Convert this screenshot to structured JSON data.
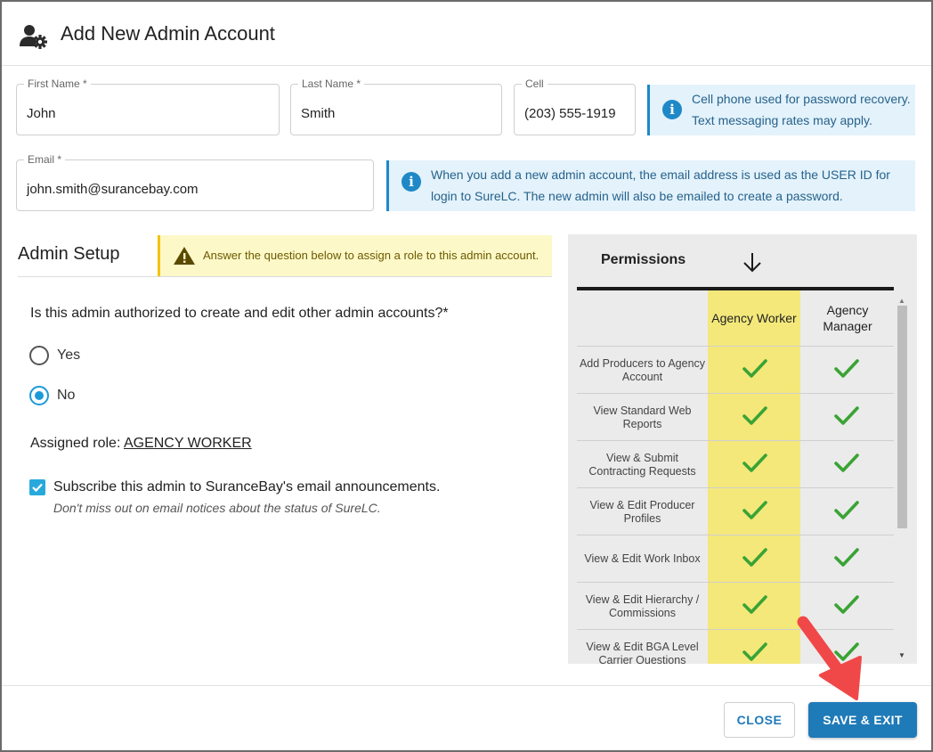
{
  "dialog": {
    "title": "Add New Admin Account",
    "title_icon": "user-gear-icon"
  },
  "form": {
    "first_name": {
      "label": "First Name *",
      "value": "John"
    },
    "last_name": {
      "label": "Last Name *",
      "value": "Smith"
    },
    "cell": {
      "label": "Cell",
      "value": "(203) 555-1919"
    },
    "email": {
      "label": "Email *",
      "value": "john.smith@surancebay.com"
    }
  },
  "info_cell": {
    "line1": "Cell phone used for password recovery.",
    "line2": "Text messaging rates may apply."
  },
  "info_email": {
    "line1": "When you add a new admin account, the email address is used as the USER ID for",
    "line2": "login to SureLC. The new admin will also be emailed to create a password."
  },
  "admin_setup": {
    "title": "Admin Setup",
    "warning": "Answer the question below to assign a role to this admin account.",
    "question": "Is this admin authorized to create and edit other admin accounts?*",
    "options": [
      {
        "label": "Yes",
        "selected": false
      },
      {
        "label": "No",
        "selected": true
      }
    ],
    "assigned_prefix": "Assigned role:",
    "assigned_role": "AGENCY WORKER",
    "subscribe_label": "Subscribe this admin to SuranceBay's email announcements.",
    "subscribe_checked": true,
    "subscribe_note": "Don't miss out on email notices about the status of SureLC."
  },
  "permissions": {
    "title": "Permissions",
    "columns": [
      "Agency Worker",
      "Agency Manager"
    ],
    "highlighted_column": "Agency Worker",
    "rows": [
      {
        "name": "Add Producers to Agency Account",
        "worker": true,
        "manager": true
      },
      {
        "name": "View Standard Web Reports",
        "worker": true,
        "manager": true
      },
      {
        "name": "View & Submit Contracting Requests",
        "worker": true,
        "manager": true
      },
      {
        "name": "View & Edit Producer Profiles",
        "worker": true,
        "manager": true
      },
      {
        "name": "View & Edit Work Inbox",
        "worker": true,
        "manager": true
      },
      {
        "name": "View & Edit Hierarchy / Commissions",
        "worker": true,
        "manager": true
      },
      {
        "name": "View & Edit BGA Level Carrier Questions",
        "worker": true,
        "manager": true
      }
    ]
  },
  "buttons": {
    "close": "CLOSE",
    "save": "SAVE & EXIT"
  },
  "colors": {
    "accent": "#1f7ab8",
    "check_green": "#3aa335",
    "highlight": "#f4e87a",
    "annotation_arrow": "#f04848"
  }
}
